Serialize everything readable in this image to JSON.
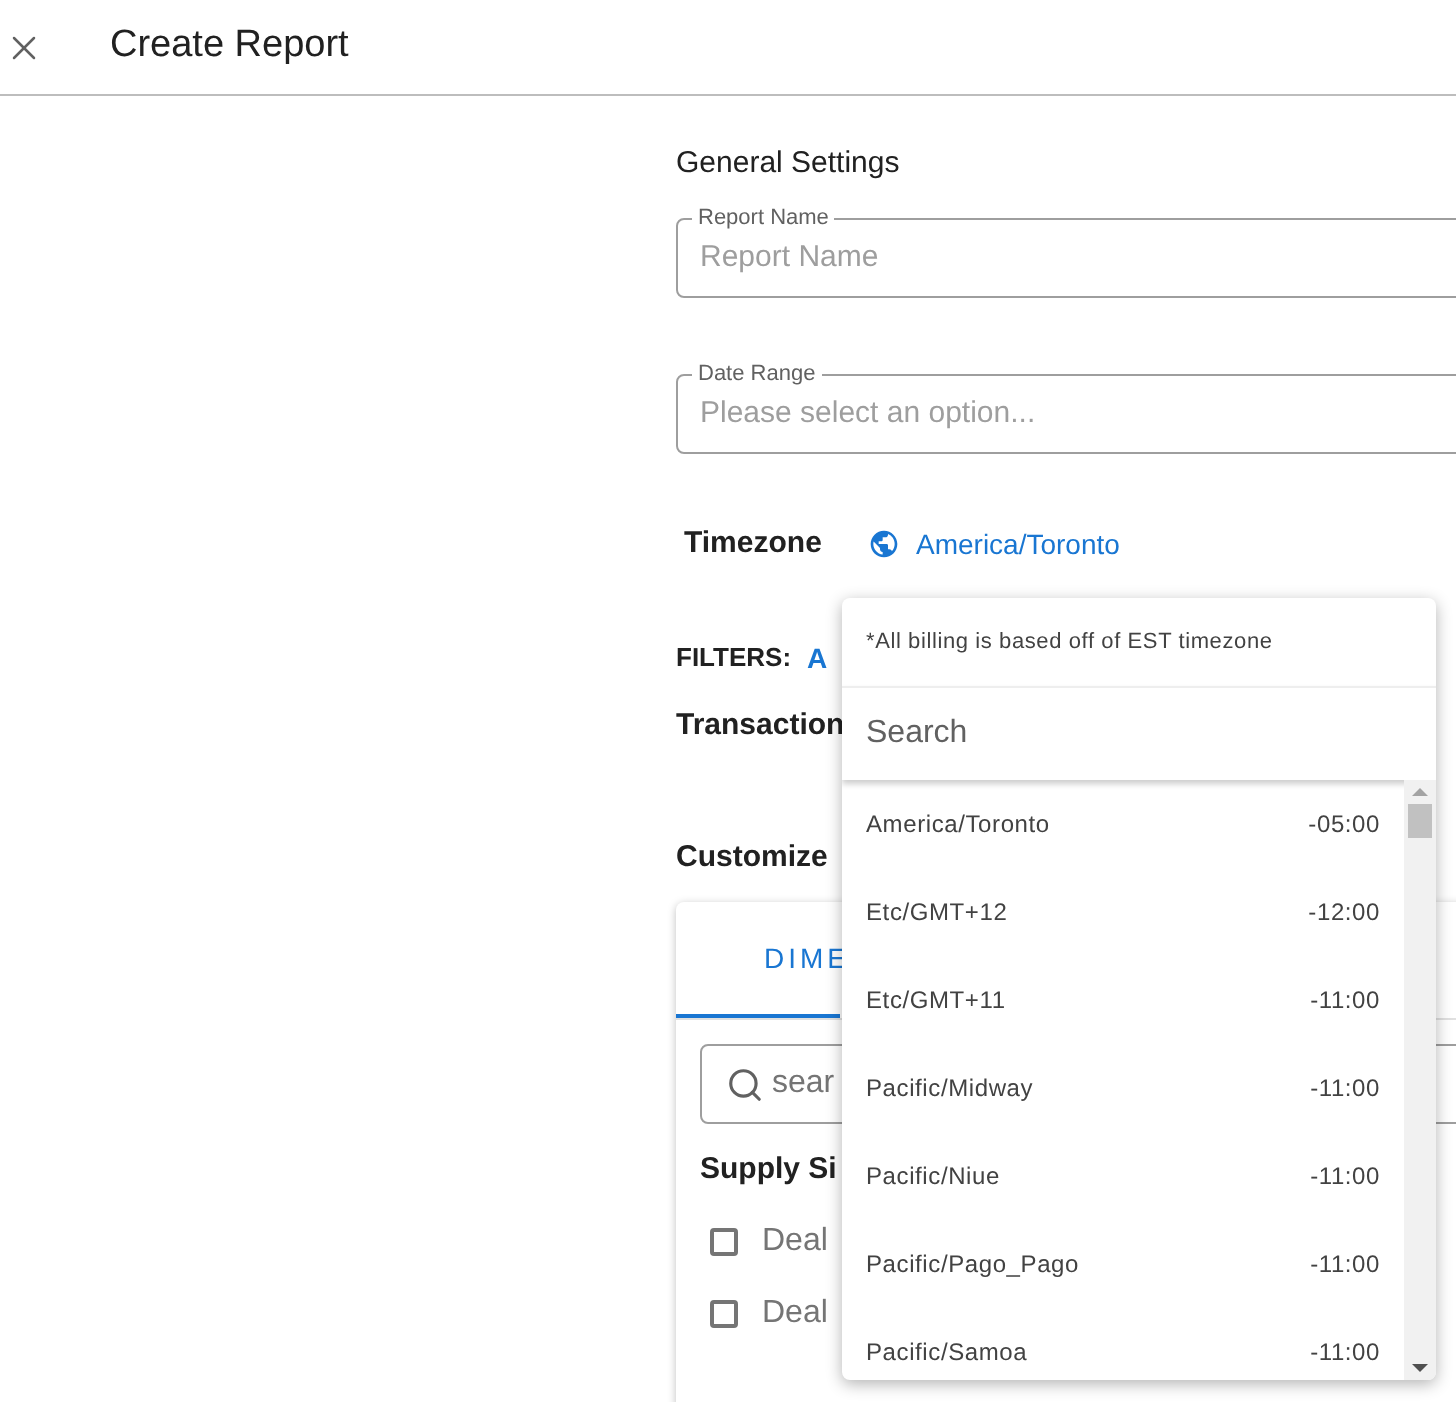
{
  "header": {
    "title": "Create Report"
  },
  "general_settings": {
    "title": "General Settings",
    "fields": [
      {
        "label": "Report Name",
        "placeholder": "Report Name"
      },
      {
        "label": "Date Range",
        "placeholder": "Please select an option..."
      }
    ]
  },
  "timezone": {
    "label": "Timezone",
    "value": "America/Toronto"
  },
  "filters": {
    "label": "FILTERS:",
    "value": "A"
  },
  "transaction": {
    "label": "Transaction"
  },
  "customize": {
    "title": "Customize"
  },
  "tabs": [
    {
      "label": "DIME",
      "selected": true
    }
  ],
  "dimension_search": {
    "placeholder": "sear"
  },
  "dimension_group": {
    "title": "Supply Si",
    "items": [
      {
        "label": "Deal",
        "checked": false
      },
      {
        "label": "Deal",
        "checked": false
      }
    ]
  },
  "timezone_dropdown": {
    "note": "*All billing is based off of EST timezone",
    "search_placeholder": "Search",
    "options": [
      {
        "name": "America/Toronto",
        "offset": "-05:00"
      },
      {
        "name": "Etc/GMT+12",
        "offset": "-12:00"
      },
      {
        "name": "Etc/GMT+11",
        "offset": "-11:00"
      },
      {
        "name": "Pacific/Midway",
        "offset": "-11:00"
      },
      {
        "name": "Pacific/Niue",
        "offset": "-11:00"
      },
      {
        "name": "Pacific/Pago_Pago",
        "offset": "-11:00"
      },
      {
        "name": "Pacific/Samoa",
        "offset": "-11:00"
      }
    ]
  }
}
